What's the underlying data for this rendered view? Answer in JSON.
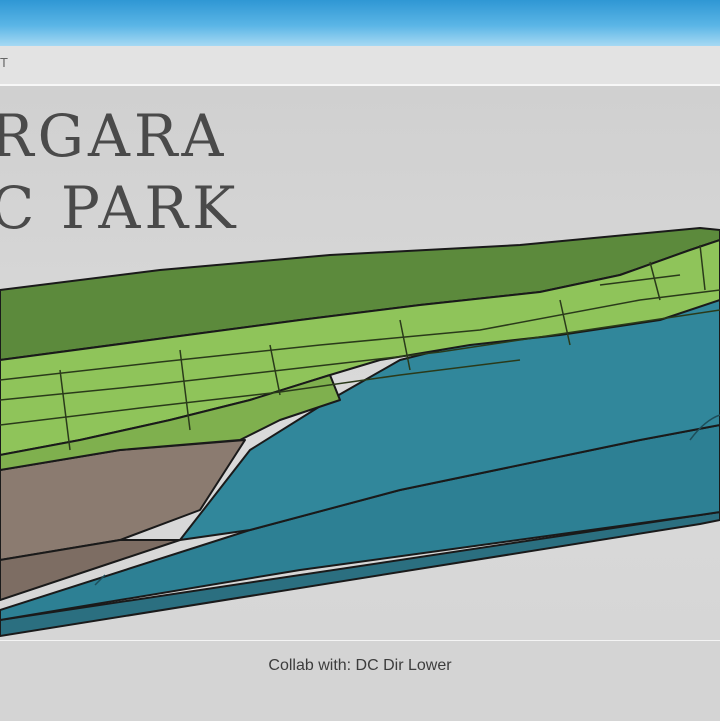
{
  "header": {
    "label": "T"
  },
  "title": {
    "line1": "RGARA",
    "line2": "C PARK"
  },
  "caption": "Collab with: DC Dir Lower",
  "colors": {
    "sky_bar": "#3a9fd8",
    "canvas": "#d6d6d6",
    "vegetation_dark": "#5c8a3c",
    "vegetation_light": "#8fc45a",
    "soil": "#8b7b70",
    "water": "#2f7f92",
    "outline": "#1a1a1a",
    "title_text": "#4a4a4a"
  }
}
